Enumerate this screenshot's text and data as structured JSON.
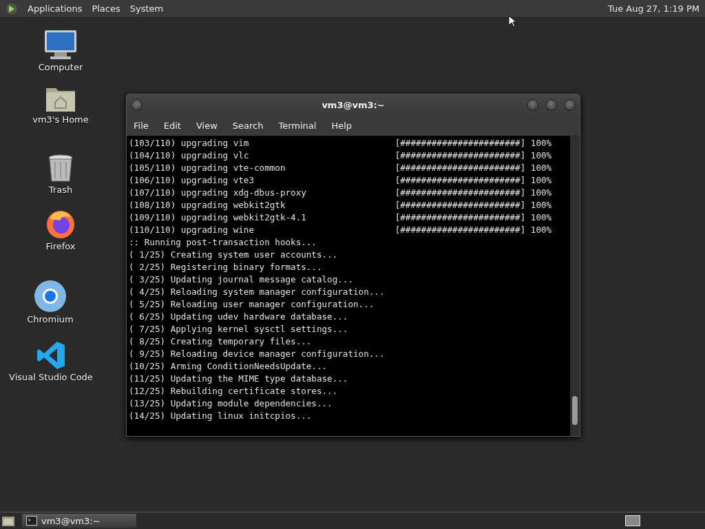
{
  "top_panel": {
    "menus": [
      "Applications",
      "Places",
      "System"
    ],
    "clock": "Tue Aug 27, 1:19 PM"
  },
  "desktop_icons": [
    {
      "kind": "computer",
      "label": "Computer"
    },
    {
      "kind": "home",
      "label": "vm3's Home"
    },
    {
      "kind": "trash",
      "label": "Trash"
    },
    {
      "kind": "firefox",
      "label": "Firefox"
    },
    {
      "kind": "chromium",
      "label": "Chromium"
    },
    {
      "kind": "vscode",
      "label": "Visual Studio Code"
    }
  ],
  "terminal": {
    "title": "vm3@vm3:~",
    "menu": [
      "File",
      "Edit",
      "View",
      "Search",
      "Terminal",
      "Help"
    ],
    "lines": [
      {
        "text": "(103/110) upgrading vim",
        "progress": "[#######################]",
        "percent": "100%"
      },
      {
        "text": "(104/110) upgrading vlc",
        "progress": "[#######################]",
        "percent": "100%"
      },
      {
        "text": "(105/110) upgrading vte-common",
        "progress": "[#######################]",
        "percent": "100%"
      },
      {
        "text": "(106/110) upgrading vte3",
        "progress": "[#######################]",
        "percent": "100%"
      },
      {
        "text": "(107/110) upgrading xdg-dbus-proxy",
        "progress": "[#######################]",
        "percent": "100%"
      },
      {
        "text": "(108/110) upgrading webkit2gtk",
        "progress": "[#######################]",
        "percent": "100%"
      },
      {
        "text": "(109/110) upgrading webkit2gtk-4.1",
        "progress": "[#######################]",
        "percent": "100%"
      },
      {
        "text": "(110/110) upgrading wine",
        "progress": "[#######################]",
        "percent": "100%"
      },
      {
        "text": ":: Running post-transaction hooks..."
      },
      {
        "text": "( 1/25) Creating system user accounts..."
      },
      {
        "text": "( 2/25) Registering binary formats..."
      },
      {
        "text": "( 3/25) Updating journal message catalog..."
      },
      {
        "text": "( 4/25) Reloading system manager configuration..."
      },
      {
        "text": "( 5/25) Reloading user manager configuration..."
      },
      {
        "text": "( 6/25) Updating udev hardware database..."
      },
      {
        "text": "( 7/25) Applying kernel sysctl settings..."
      },
      {
        "text": "( 8/25) Creating temporary files..."
      },
      {
        "text": "( 9/25) Reloading device manager configuration..."
      },
      {
        "text": "(10/25) Arming ConditionNeedsUpdate..."
      },
      {
        "text": "(11/25) Updating the MIME type database..."
      },
      {
        "text": "(12/25) Rebuilding certificate stores..."
      },
      {
        "text": "(13/25) Updating module dependencies..."
      },
      {
        "text": "(14/25) Updating linux initcpios..."
      }
    ]
  },
  "taskbar": {
    "tasks": [
      {
        "label": "vm3@vm3:~",
        "selected": true
      }
    ]
  }
}
